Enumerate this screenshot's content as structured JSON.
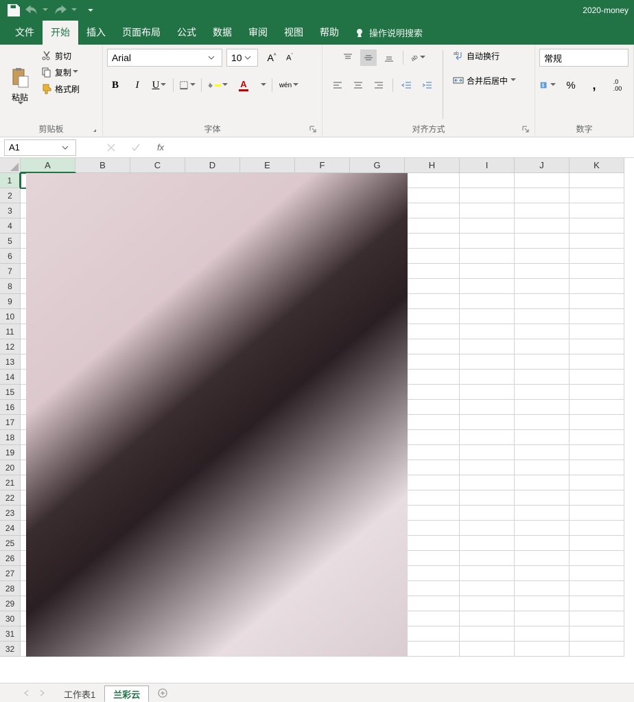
{
  "title": "2020-money",
  "qat": {
    "save": "保存",
    "undo": "撤销",
    "redo": "恢复",
    "customize": "自定义快速访问工具栏"
  },
  "tabs": [
    "文件",
    "开始",
    "插入",
    "页面布局",
    "公式",
    "数据",
    "审阅",
    "视图",
    "帮助"
  ],
  "active_tab": 1,
  "tell_me": "操作说明搜索",
  "ribbon": {
    "clipboard": {
      "label": "剪贴板",
      "paste": "粘贴",
      "cut": "剪切",
      "copy": "复制",
      "format_painter": "格式刷"
    },
    "font": {
      "label": "字体",
      "name": "Arial",
      "size": "10",
      "bold": "B",
      "italic": "I",
      "underline": "U",
      "pinyin": "wén"
    },
    "alignment": {
      "label": "对齐方式",
      "wrap": "自动换行",
      "merge": "合并后居中"
    },
    "number": {
      "label": "数字",
      "format": "常规"
    }
  },
  "name_box": "A1",
  "formula": "",
  "columns": [
    "A",
    "B",
    "C",
    "D",
    "E",
    "F",
    "G",
    "H",
    "I",
    "J",
    "K"
  ],
  "rows": 32,
  "active_cell": {
    "row": 1,
    "col": 0
  },
  "image": {
    "left_col": 0,
    "top_row": 0,
    "width_cols": 7,
    "height_rows": 32
  },
  "sheets": [
    "工作表1",
    "兰彩云"
  ],
  "active_sheet": 1
}
